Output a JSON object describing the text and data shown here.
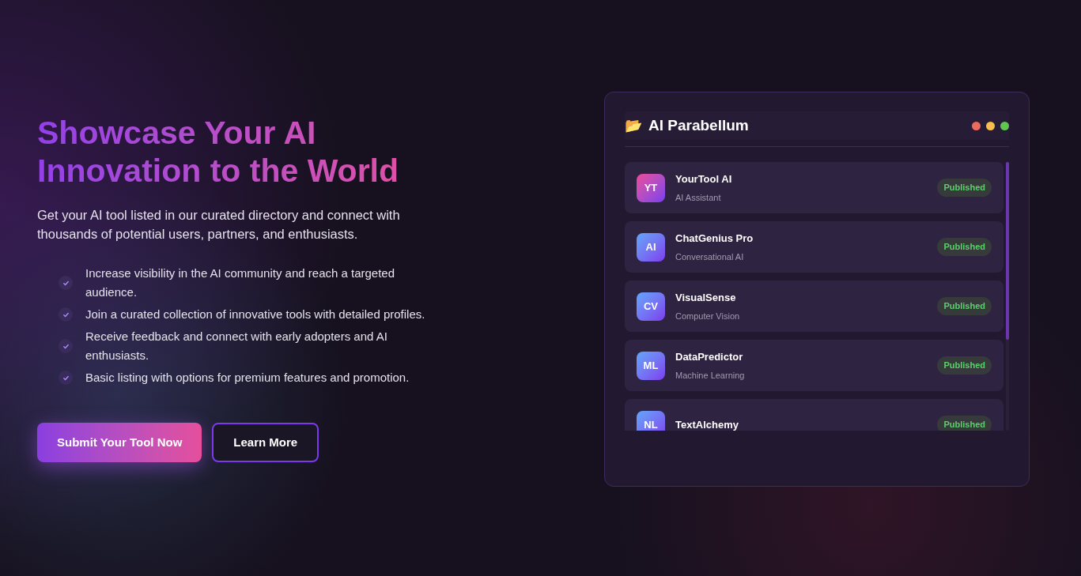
{
  "hero": {
    "title": "Showcase Your AI Innovation to the World",
    "subtitle": "Get your AI tool listed in our curated directory and connect with thousands of potential users, partners, and enthusiasts.",
    "benefits": [
      "Increase visibility in the AI community and reach a targeted audience.",
      "Join a curated collection of innovative tools with detailed profiles.",
      "Receive feedback and connect with early adopters and AI enthusiasts.",
      "Basic listing with options for premium features and promotion."
    ],
    "buttons": [
      {
        "label": "Submit Your Tool Now",
        "kind": "primary"
      },
      {
        "label": "Learn More",
        "kind": "outline"
      }
    ]
  },
  "window": {
    "icon": "📂",
    "title": "AI Parabellum",
    "tools": [
      {
        "initials": "YT",
        "name": "YourTool AI",
        "category": "AI Assistant",
        "status": "Published",
        "kind": "pink"
      },
      {
        "initials": "AI",
        "name": "ChatGenius Pro",
        "category": "Conversational AI",
        "status": "Published",
        "kind": "blue"
      },
      {
        "initials": "CV",
        "name": "VisualSense",
        "category": "Computer Vision",
        "status": "Published",
        "kind": "blue"
      },
      {
        "initials": "ML",
        "name": "DataPredictor",
        "category": "Machine Learning",
        "status": "Published",
        "kind": "blue"
      },
      {
        "initials": "NL",
        "name": "TextAlchemy",
        "status": "Published",
        "kind": "blue"
      }
    ]
  }
}
